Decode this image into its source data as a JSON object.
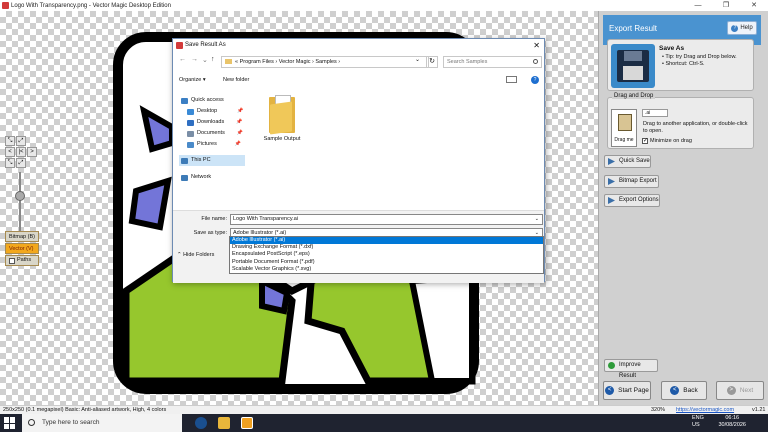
{
  "app": {
    "title": "Logo With Transparency.png - Vector Magic Desktop Edition",
    "controls": [
      "—",
      "❐",
      "✕"
    ]
  },
  "tools": {
    "zoom": [
      "⤡",
      "⤢",
      "<",
      "|<",
      ">",
      "⤡",
      "⤢"
    ],
    "modes": {
      "bitmap": "Bitmap (B)",
      "vector": "Vector (V)",
      "paths": "Paths"
    }
  },
  "panel": {
    "title": "Export Result",
    "help": "Help",
    "save_as_title": "Save As",
    "save_tips": [
      "• Tip: try Drag and Drop below.",
      "• Shortcut: Ctrl-S."
    ],
    "drag_group_title": "Drag and Drop",
    "format_value": ".ai",
    "drag_label": "Drag me",
    "drag_text": "Drag to another application, or double-click to open.",
    "minimize_label": "Minimize on drag",
    "quick_save": "Quick Save",
    "bitmap_export": "Bitmap Export",
    "export_options": "Export Options",
    "improve_result": "Improve Result",
    "start_page": "Start Page",
    "back": "Back",
    "next": "Next"
  },
  "status": {
    "left": "250x250 (0.1 megapixel)  Basic: Anti-aliased artwork, High, 4 colors",
    "zoom": "320%",
    "url": "https://vectormagic.com",
    "version": "v1.21"
  },
  "taskbar": {
    "search_placeholder": "Type here to search",
    "lang": "ENG\nUS",
    "time": "06:16",
    "date": "30/08/2026"
  },
  "dialog": {
    "title": "Save Result As",
    "path": "«  Program Files  ›  Vector Magic  ›  Samples  ›",
    "search_placeholder": "Search Samples",
    "organize": "Organize ▾",
    "new_folder": "New folder",
    "nav": [
      {
        "label": "Quick access",
        "color": "#3b7fc4"
      },
      {
        "label": "Desktop",
        "color": "#3a8ad6"
      },
      {
        "label": "Downloads",
        "color": "#2f6fc2"
      },
      {
        "label": "Documents",
        "color": "#7a8ea6"
      },
      {
        "label": "Pictures",
        "color": "#4a8ac9"
      },
      {
        "label": "This PC",
        "color": "#3d7bb7"
      },
      {
        "label": "Network",
        "color": "#3d7bb7"
      }
    ],
    "file_name_label": "File name:",
    "file_name_value": "Logo With Transparency.ai",
    "save_type_label": "Save as type:",
    "save_type_value": "Adobe Illustrator (*.ai)",
    "hide_folders": "Hide Folders",
    "folder_item": "Sample Output",
    "type_options": [
      "Adobe Illustrator (*.ai)",
      "Drawing Exchange Format (*.dxf)",
      "Encapsulated PostScript (*.eps)",
      "Portable Document Format (*.pdf)",
      "Scalable Vector Graphics (*.svg)"
    ]
  },
  "colors": {
    "accent": "#4a93d0",
    "green_fill": "#96c72d",
    "purple_fill": "#7375d8",
    "vector_mode": "#f2a81d"
  }
}
